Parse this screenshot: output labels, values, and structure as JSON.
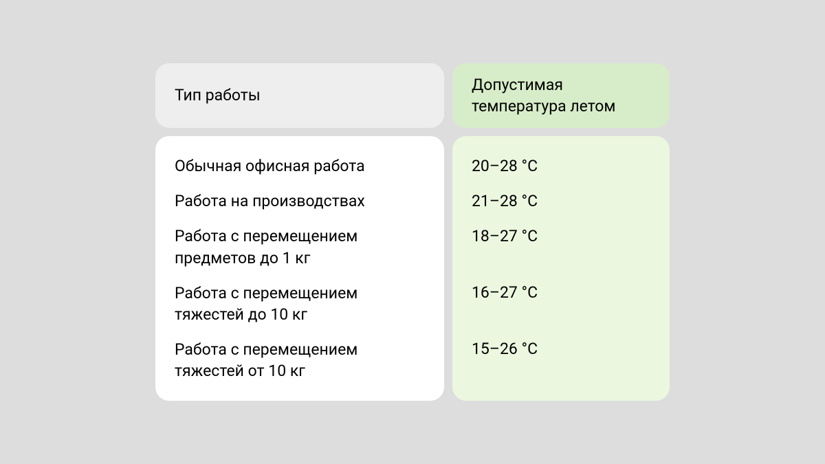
{
  "chart_data": {
    "type": "table",
    "title": "",
    "columns": [
      "Тип работы",
      "Допустимая температура летом"
    ],
    "rows": [
      {
        "work_type": "Обычная офисная работа",
        "temperature": "20–28 °C"
      },
      {
        "work_type": "Работа на производствах",
        "temperature": "21–28 °C"
      },
      {
        "work_type": "Работа с перемещением предметов до 1 кг",
        "temperature": "18–27 °C"
      },
      {
        "work_type": "Работа с перемещением тяжестей до 10 кг",
        "temperature": "16–27 °C"
      },
      {
        "work_type": "Работа с перемещением тяжестей от 10 кг",
        "temperature": "15–26 °C"
      }
    ]
  },
  "headers": {
    "col1": "Тип работы",
    "col2": "Допустимая температура летом"
  }
}
